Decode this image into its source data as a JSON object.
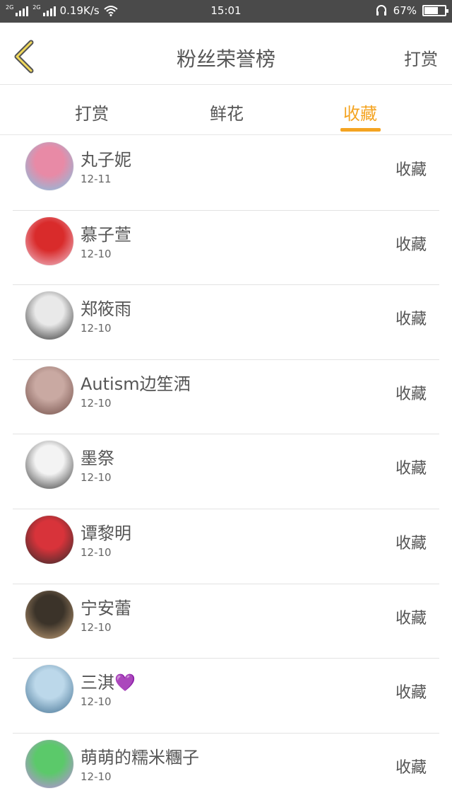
{
  "status_bar": {
    "sim1_label": "2G",
    "sim2_label": "2G",
    "speed": "0.19K/s",
    "time": "15:01",
    "battery_text": "67%",
    "battery_level": 0.67
  },
  "header": {
    "title": "粉丝荣誉榜",
    "action_label": "打赏"
  },
  "tabs": [
    {
      "label": "打赏",
      "active": false
    },
    {
      "label": "鲜花",
      "active": false
    },
    {
      "label": "收藏",
      "active": true
    }
  ],
  "accent_color": "#f4a422",
  "fans": [
    {
      "name": "丸子妮",
      "date": "12-11",
      "action": "收藏",
      "avatar_colors": [
        "#e88aa6",
        "#7bc6e8"
      ]
    },
    {
      "name": "慕子萱",
      "date": "12-10",
      "action": "收藏",
      "avatar_colors": [
        "#d92b2b",
        "#f0c7d6"
      ]
    },
    {
      "name": "郑筱雨",
      "date": "12-10",
      "action": "收藏",
      "avatar_colors": [
        "#e9e9e9",
        "#2a2a2a"
      ]
    },
    {
      "name": "Autism边笙洒",
      "date": "12-10",
      "action": "收藏",
      "avatar_colors": [
        "#c9a9a2",
        "#6e4a44"
      ]
    },
    {
      "name": "墨祭",
      "date": "12-10",
      "action": "收藏",
      "avatar_colors": [
        "#f3f3f3",
        "#333333"
      ]
    },
    {
      "name": "谭黎明",
      "date": "12-10",
      "action": "收藏",
      "avatar_colors": [
        "#d8333a",
        "#2b2b2b"
      ]
    },
    {
      "name": "宁安蕾",
      "date": "12-10",
      "action": "收藏",
      "avatar_colors": [
        "#3b3329",
        "#c7a37a"
      ]
    },
    {
      "name": "三淇💜",
      "date": "12-10",
      "action": "收藏",
      "avatar_colors": [
        "#bcd8ea",
        "#3d6c8e"
      ]
    },
    {
      "name": "萌萌的糯米糰子",
      "date": "12-10",
      "action": "收藏",
      "avatar_colors": [
        "#5bc96a",
        "#c487e8"
      ]
    }
  ]
}
